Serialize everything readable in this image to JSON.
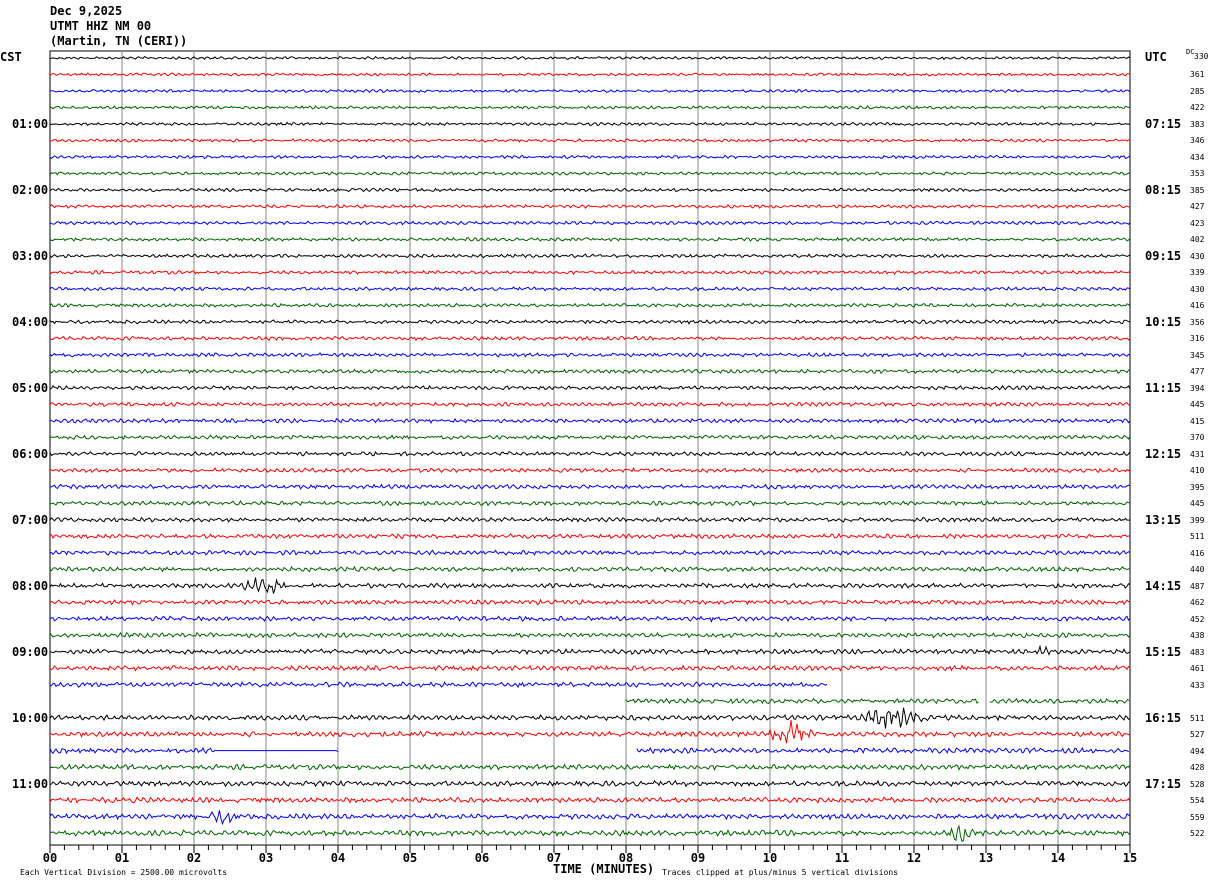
{
  "header": {
    "date": "Dec 9,2025",
    "station": "UTMT HHZ NM 00",
    "location": "(Martin, TN (CERI))"
  },
  "chart_data": {
    "type": "line",
    "title": "Dec 9,2025 UTMT HHZ NM 00 (Martin, TN (CERI))",
    "xlabel": "TIME (MINUTES)",
    "xlim": [
      0,
      15
    ],
    "x_ticks": [
      "00",
      "01",
      "02",
      "03",
      "04",
      "05",
      "06",
      "07",
      "08",
      "09",
      "10",
      "11",
      "12",
      "13",
      "14",
      "15"
    ],
    "left_axis_title": "CST",
    "right_axis_title": "UTC",
    "dc_title": "DC",
    "left_labels": [
      "01:00",
      "02:00",
      "03:00",
      "04:00",
      "05:00",
      "06:00",
      "07:00",
      "08:00",
      "09:00",
      "10:00",
      "11:00"
    ],
    "right_labels": [
      "07:15",
      "08:15",
      "09:15",
      "10:15",
      "11:15",
      "12:15",
      "13:15",
      "14:15",
      "15:15",
      "16:15",
      "17:15"
    ],
    "trace_colors": [
      "#000000",
      "#ff0000",
      "#0000ff",
      "#006400"
    ],
    "trace_count": 48,
    "dc_values": [
      "330",
      "361",
      "285",
      "422",
      "383",
      "346",
      "434",
      "353",
      "385",
      "427",
      "423",
      "402",
      "430",
      "339",
      "430",
      "416",
      "356",
      "316",
      "345",
      "477",
      "394",
      "445",
      "415",
      "370",
      "431",
      "410",
      "395",
      "445",
      "399",
      "511",
      "416",
      "440",
      "487",
      "462",
      "452",
      "438",
      "483",
      "461",
      "433",
      "",
      "511",
      "527",
      "494",
      "428",
      "528",
      "554",
      "559",
      "522"
    ],
    "partial_traces": [
      {
        "trace": 38,
        "segments": [
          [
            0,
            10.8
          ]
        ]
      },
      {
        "trace": 39,
        "segments": [
          [
            8.0,
            12.9
          ],
          [
            13.05,
            15
          ]
        ]
      },
      {
        "trace": 42,
        "segments": [
          [
            0,
            4.0
          ],
          [
            8.15,
            15
          ]
        ],
        "flat_between": [
          2.3,
          4.0
        ]
      }
    ],
    "events": [
      {
        "trace": 32,
        "minute": 2.95,
        "amplitude": 2.2,
        "duration": 0.35
      },
      {
        "trace": 40,
        "minute": 11.7,
        "amplitude": 2.5,
        "duration": 0.5
      },
      {
        "trace": 41,
        "minute": 10.3,
        "amplitude": 2.6,
        "duration": 0.35
      },
      {
        "trace": 46,
        "minute": 2.4,
        "amplitude": 1.2,
        "duration": 0.3
      },
      {
        "trace": 47,
        "minute": 12.65,
        "amplitude": 2.5,
        "duration": 0.2
      },
      {
        "trace": 34,
        "minute": 9.3,
        "amplitude": 1.0,
        "duration": 0.15
      },
      {
        "trace": 36,
        "minute": 13.8,
        "amplitude": 1.2,
        "duration": 0.2
      }
    ],
    "scale_note": "Each Vertical Division = 2500.00 microvolts",
    "clip_note": "Traces clipped at plus/minus 5 vertical divisions"
  }
}
